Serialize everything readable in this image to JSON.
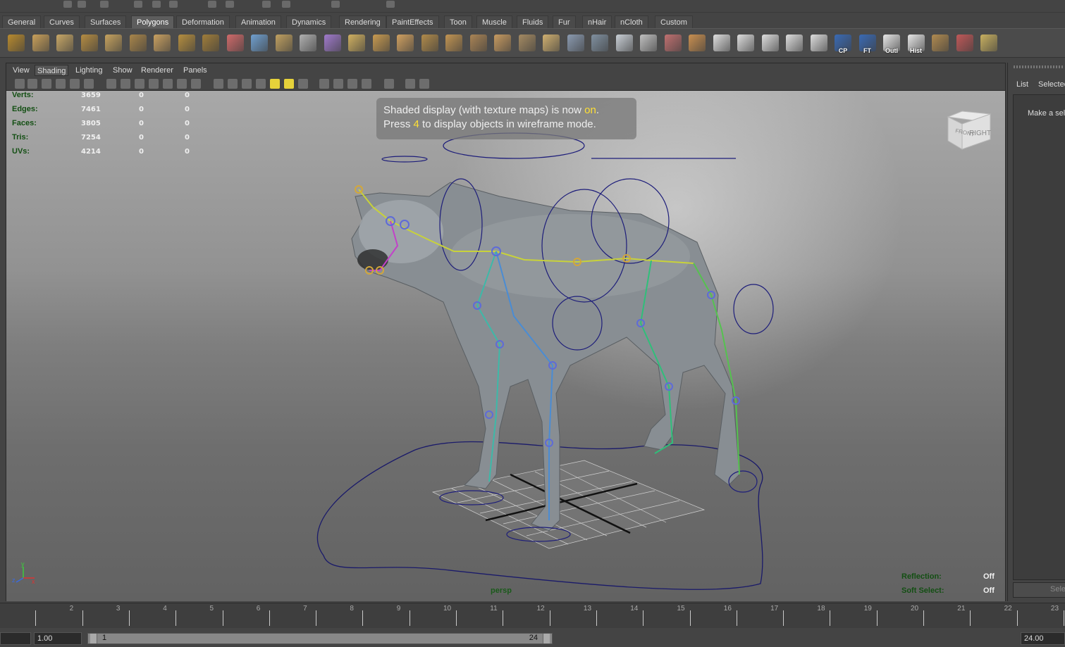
{
  "menu_tabs": [
    "General",
    "Curves",
    "Surfaces",
    "Polygons",
    "Deformation",
    "Animation",
    "Dynamics",
    "Rendering",
    "PaintEffects",
    "Toon",
    "Muscle",
    "Fluids",
    "Fur",
    "nHair",
    "nCloth",
    "Custom"
  ],
  "active_tab": "Polygons",
  "shelf_labels": {
    "cp": "CP",
    "ft": "FT",
    "outl": "Outl",
    "hist": "Hist"
  },
  "panel_menu": [
    "View",
    "Shading",
    "Lighting",
    "Show",
    "Renderer",
    "Panels"
  ],
  "hud": [
    {
      "label": "Verts:",
      "v1": "3659",
      "v2": "0",
      "v3": "0"
    },
    {
      "label": "Edges:",
      "v1": "7461",
      "v2": "0",
      "v3": "0"
    },
    {
      "label": "Faces:",
      "v1": "3805",
      "v2": "0",
      "v3": "0"
    },
    {
      "label": "Tris:",
      "v1": "7254",
      "v2": "0",
      "v3": "0"
    },
    {
      "label": "UVs:",
      "v1": "4214",
      "v2": "0",
      "v3": "0"
    }
  ],
  "message": {
    "line1a": "Shaded display (with texture maps) is now ",
    "line1b": "on",
    "line1c": ".",
    "line2a": "Press ",
    "line2b": "4",
    "line2c": " to display objects in wireframe mode."
  },
  "viewcube": {
    "front": "FRONT",
    "right": "RIGHT"
  },
  "camera": "persp",
  "axis": {
    "y": "y",
    "x": "x",
    "z": "z"
  },
  "status": [
    {
      "label": "Reflection:",
      "value": "Off"
    },
    {
      "label": "Soft Select:",
      "value": "Off"
    }
  ],
  "right_panel": {
    "tab1": "List",
    "tab2": "Selected",
    "hint": "Make a sele",
    "bottom": "Sele"
  },
  "timeline_ticks": [
    "2",
    "3",
    "4",
    "5",
    "6",
    "7",
    "8",
    "9",
    "10",
    "11",
    "12",
    "13",
    "14",
    "15",
    "16",
    "17",
    "18",
    "19",
    "20",
    "21",
    "22",
    "23"
  ],
  "range": {
    "start": "1.00",
    "slider_start": "1",
    "slider_end": "24",
    "end": "24.00"
  },
  "colors": {
    "bg": "#444444",
    "hud_green": "#134f13",
    "highlight": "#ffe034"
  }
}
